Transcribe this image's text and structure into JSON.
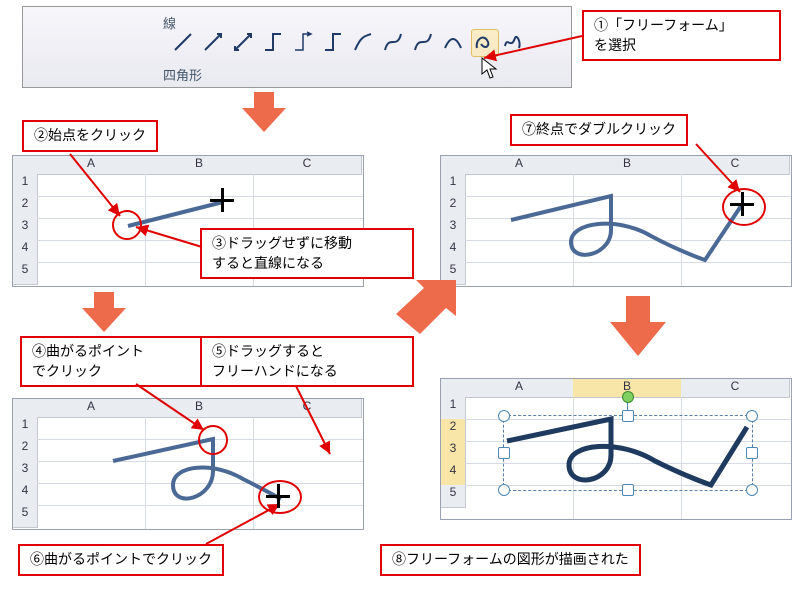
{
  "ribbon": {
    "lines_label": "線",
    "rect_label": "四角形",
    "icons": [
      "line",
      "arrow",
      "double-arrow",
      "elbow",
      "elbow-arrow",
      "elbow-double",
      "curve",
      "curve-arrow",
      "curve-double",
      "curve2",
      "zigzag",
      "arc",
      "freeform",
      "scribble"
    ],
    "selected_icon": "freeform"
  },
  "columns": [
    "A",
    "B",
    "C"
  ],
  "rows": [
    "1",
    "2",
    "3",
    "4",
    "5"
  ],
  "steps": {
    "s1": "①「フリーフォーム」\nを選択",
    "s2": "②始点をクリック",
    "s3": "③ドラッグせずに移動\nすると直線になる",
    "s4": "④曲がるポイント\nでクリック",
    "s5": "⑤ドラッグすると\nフリーハンドになる",
    "s6": "⑥曲がるポイントでクリック",
    "s7": "⑦終点でダブルクリック",
    "s8": "⑧フリーフォームの図形が描画された"
  }
}
